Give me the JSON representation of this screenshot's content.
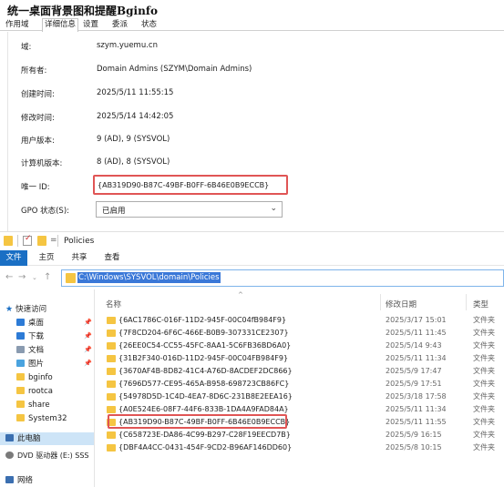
{
  "gpo": {
    "title": "统一桌面背景图和提醒Bginfo",
    "tabs": [
      "作用域",
      "详细信息",
      "设置",
      "委派",
      "状态"
    ],
    "fields": [
      {
        "label": "域:",
        "value": "szym.yuemu.cn"
      },
      {
        "label": "所有者:",
        "value": "Domain Admins (SZYM\\Domain Admins)"
      },
      {
        "label": "创建时间:",
        "value": "2025/5/11 11:55:15"
      },
      {
        "label": "修改时间:",
        "value": "2025/5/14 14:42:05"
      },
      {
        "label": "用户版本:",
        "value": "9 (AD), 9 (SYSVOL)"
      },
      {
        "label": "计算机版本:",
        "value": "8 (AD), 8 (SYSVOL)"
      },
      {
        "label": "唯一 ID:",
        "value": "{AB319D90-B87C-49BF-B0FF-6B46E0B9ECCB}"
      }
    ],
    "status_label": "GPO 状态(S):",
    "status_value": "已启用"
  },
  "explorer": {
    "title": "Policies",
    "ribbon_tabs": [
      "文件",
      "主页",
      "共享",
      "查看"
    ],
    "address": "C:\\Windows\\SYSVOL\\domain\\Policies",
    "nav": {
      "quick_access": "快速访问",
      "items": [
        "桌面",
        "下载",
        "文档",
        "图片",
        "bginfo",
        "rootca",
        "share",
        "System32"
      ],
      "this_pc": "此电脑",
      "dvd": "DVD 驱动器 (E:) SSS",
      "network": "网络"
    },
    "columns": {
      "name": "名称",
      "date": "修改日期",
      "type": "类型"
    },
    "files": [
      {
        "name": "{6AC1786C-016F-11D2-945F-00C04fB984F9}",
        "date": "2025/3/17 15:01",
        "type": "文件夹"
      },
      {
        "name": "{7F8CD204-6F6C-466E-B0B9-307331CE2307}",
        "date": "2025/5/11 11:45",
        "type": "文件夹"
      },
      {
        "name": "{26EE0C54-CC55-45FC-8AA1-5C6FB36BD6A0}",
        "date": "2025/5/14 9:43",
        "type": "文件夹"
      },
      {
        "name": "{31B2F340-016D-11D2-945F-00C04FB984F9}",
        "date": "2025/5/11 11:34",
        "type": "文件夹"
      },
      {
        "name": "{3670AF4B-8D82-41C4-A76D-8ACDEF2DC866}",
        "date": "2025/5/9 17:47",
        "type": "文件夹"
      },
      {
        "name": "{7696D577-CE95-465A-B958-698723CB86FC}",
        "date": "2025/5/9 17:51",
        "type": "文件夹"
      },
      {
        "name": "{54978D5D-1C4D-4EA7-8D6C-231B8E2EEA16}",
        "date": "2025/3/18 17:58",
        "type": "文件夹"
      },
      {
        "name": "{A0E524E6-08F7-44F6-833B-1DA4A9FAD84A}",
        "date": "2025/5/11 11:34",
        "type": "文件夹"
      },
      {
        "name": "{AB319D90-B87C-49BF-B0FF-6B46E0B9ECCB}",
        "date": "2025/5/11 11:55",
        "type": "文件夹"
      },
      {
        "name": "{C658723E-DA86-4C99-B297-C28F19EECD7B}",
        "date": "2025/5/9 16:15",
        "type": "文件夹"
      },
      {
        "name": "{DBF4A4CC-0431-454F-9CD2-B96AF146DD60}",
        "date": "2025/5/8 10:15",
        "type": "文件夹"
      }
    ]
  }
}
